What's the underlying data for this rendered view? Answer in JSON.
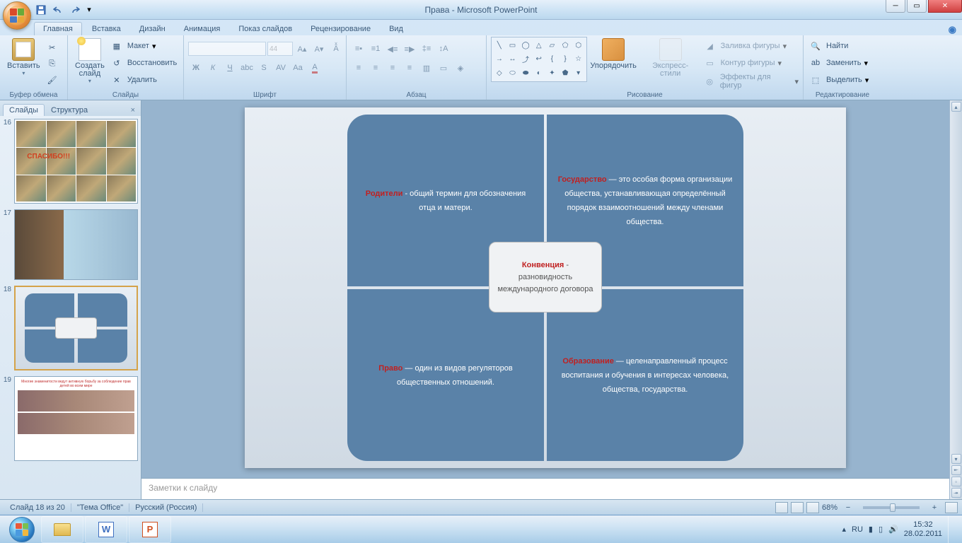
{
  "app": {
    "title": "Права - Microsoft PowerPoint"
  },
  "tabs": [
    "Главная",
    "Вставка",
    "Дизайн",
    "Анимация",
    "Показ слайдов",
    "Рецензирование",
    "Вид"
  ],
  "active_tab": 0,
  "ribbon": {
    "clipboard": {
      "label": "Буфер обмена",
      "paste": "Вставить"
    },
    "slides": {
      "label": "Слайды",
      "new": "Создать\nслайд",
      "layout": "Макет",
      "reset": "Восстановить",
      "delete": "Удалить"
    },
    "font": {
      "label": "Шрифт",
      "size": "44"
    },
    "paragraph": {
      "label": "Абзац"
    },
    "drawing": {
      "label": "Рисование",
      "arrange": "Упорядочить",
      "quickstyles": "Экспресс-стили",
      "fill": "Заливка фигуры",
      "outline": "Контур фигуры",
      "effects": "Эффекты для фигур"
    },
    "editing": {
      "label": "Редактирование",
      "find": "Найти",
      "replace": "Заменить",
      "select": "Выделить"
    }
  },
  "sidepanel": {
    "tabs": [
      "Слайды",
      "Структура"
    ],
    "active": 0
  },
  "thumbs": [
    {
      "num": "16",
      "type": "collage",
      "overlay": "СПАСИБО!!!"
    },
    {
      "num": "17",
      "type": "dog"
    },
    {
      "num": "18",
      "type": "diagram",
      "active": true
    },
    {
      "num": "19",
      "type": "celeb",
      "title": "Многие знаменитости ведут активную борьбу за соблюдение прав детей во всем мире"
    }
  ],
  "slide": {
    "q1": {
      "term": "Родители",
      "text": " - общий термин для обозначения отца и матери."
    },
    "q2": {
      "term": "Государство",
      "text": " — это особая форма организации общества, устанавливающая определённый порядок взаимоотношений между членами общества."
    },
    "q3": {
      "term": "Право",
      "text": " — один из видов регуляторов общественных отношений."
    },
    "q4": {
      "term": "Образование",
      "text": " — целенаправленный процесс воспитания и обучения в интересах человека, общества, государства."
    },
    "center": {
      "term": "Конвенция",
      "text": " - разновидность международного договора"
    }
  },
  "notes": {
    "placeholder": "Заметки к слайду"
  },
  "status": {
    "slide": "Слайд 18 из 20",
    "theme": "\"Тема Office\"",
    "lang": "Русский (Россия)",
    "zoom": "68%"
  },
  "tray": {
    "lang": "RU",
    "time": "15:32",
    "date": "28.02.2011"
  }
}
